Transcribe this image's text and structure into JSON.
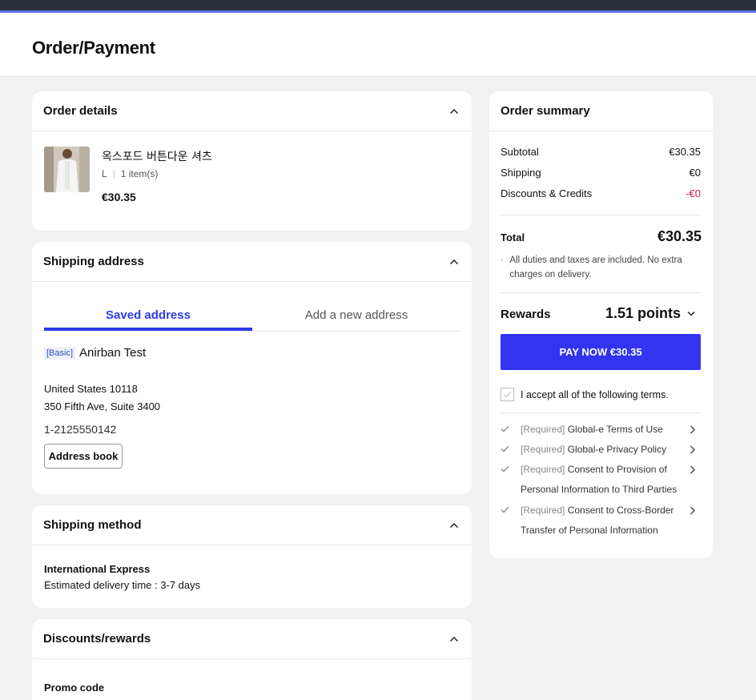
{
  "page": {
    "title": "Order/Payment"
  },
  "colors": {
    "accent": "#2c3be8",
    "pay_button": "#3333f0",
    "negative": "#d6194b"
  },
  "order_details": {
    "title": "Order details",
    "item": {
      "name": "옥스포드 버튼다운 셔츠",
      "size": "L",
      "quantity": "1 item(s)",
      "price": "€30.35"
    }
  },
  "shipping_address": {
    "title": "Shipping address",
    "tabs": [
      {
        "label": "Saved address"
      },
      {
        "label": "Add a new address"
      }
    ],
    "badge": "[Basic]",
    "name": "Anirban Test",
    "line1": "United States 10118",
    "line2": "350 Fifth Ave, Suite 3400",
    "phone": "1-2125550142",
    "address_book_label": "Address book"
  },
  "shipping_method": {
    "title": "Shipping method",
    "name": "International Express",
    "eta": "Estimated delivery time : 3-7 days"
  },
  "discounts": {
    "title": "Discounts/rewards",
    "promo_label": "Promo code"
  },
  "summary": {
    "title": "Order summary",
    "subtotal_label": "Subtotal",
    "subtotal": "€30.35",
    "shipping_label": "Shipping",
    "shipping": "€0",
    "discounts_label": "Discounts & Credits",
    "discounts": "-€0",
    "total_label": "Total",
    "total": "€30.35",
    "tax_note": "All duties and taxes are included. No extra charges on delivery.",
    "rewards_label": "Rewards",
    "rewards_value": "1.51 points",
    "pay_label": "PAY NOW €30.35",
    "accept_label": "I accept all of the following terms.",
    "terms": [
      {
        "req": "[Required]",
        "text": " Global-e Terms of Use"
      },
      {
        "req": "[Required]",
        "text": " Global-e Privacy Policy"
      },
      {
        "req": "[Required]",
        "text": " Consent to Provision of Personal Information to Third Parties"
      },
      {
        "req": "[Required]",
        "text": " Consent to Cross-Border Transfer of Personal Information"
      }
    ]
  }
}
